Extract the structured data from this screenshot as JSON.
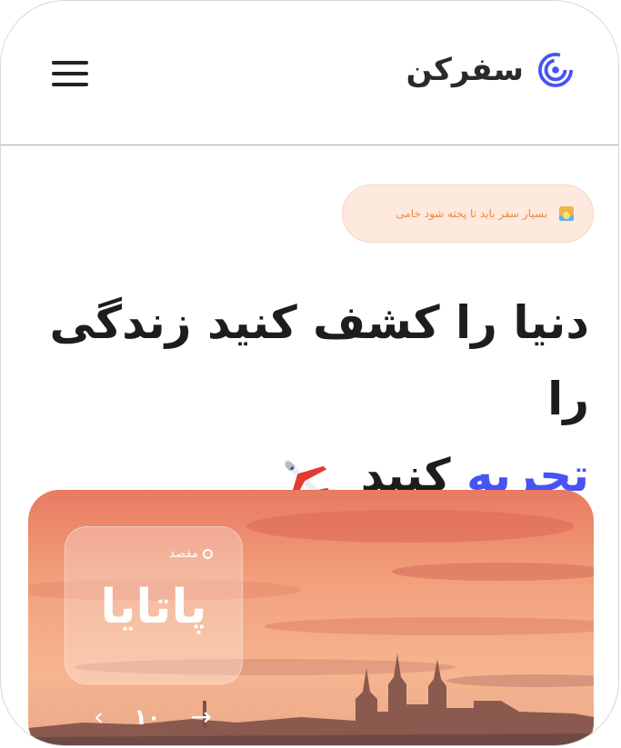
{
  "header": {
    "brand_name": "سفرکن",
    "menu_icon": "hamburger-menu-icon",
    "logo_icon": "spiral-logo-icon",
    "logo_color": "#4654f3"
  },
  "badge": {
    "text": "بسیار سفر باید تا پخته شود خامی",
    "icon": "sunrise-icon"
  },
  "headline": {
    "line1": "دنیا را کشف کنید زندگی را",
    "accent": "تجربه",
    "line2_rest": "کنید",
    "emoji_icon": "airplane-icon",
    "accent_color": "#4654f3"
  },
  "hero": {
    "location_label": "مقصد",
    "city": "پاتایا",
    "nav_text": "۱۰",
    "prev_icon": "arrow-left-icon",
    "next_icon": "arrow-right-icon"
  }
}
